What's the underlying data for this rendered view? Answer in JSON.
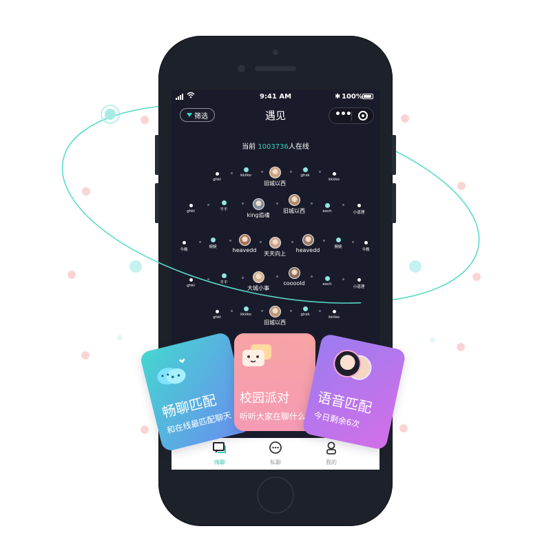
{
  "status_bar": {
    "time": "9:41 AM",
    "battery": "100%"
  },
  "nav": {
    "filter_label": "筛选",
    "title": "遇见"
  },
  "online": {
    "prefix": "当前 ",
    "count": "1003736",
    "suffix": "人在线"
  },
  "nodes": [
    {
      "label": "ghkl"
    },
    {
      "label": "kkiiko"
    },
    {
      "label": "旧城以西"
    },
    {
      "label": "ghsk"
    },
    {
      "label": "kkiiko"
    },
    {
      "label": "ghkl"
    },
    {
      "label": "千千"
    },
    {
      "label": "king追魂"
    },
    {
      "label": "旧城以西"
    },
    {
      "label": "eoch"
    },
    {
      "label": "小道理"
    },
    {
      "label": "今晚"
    },
    {
      "label": "婉婉"
    },
    {
      "label": "heavedd"
    },
    {
      "label": "天天向上"
    },
    {
      "label": "heavedd"
    },
    {
      "label": "婉婉"
    },
    {
      "label": "今晚"
    },
    {
      "label": "ghkl"
    },
    {
      "label": "千千"
    },
    {
      "label": "大城小事"
    },
    {
      "label": "coooold"
    },
    {
      "label": "eoch"
    },
    {
      "label": "小道理"
    },
    {
      "label": "ghkl"
    },
    {
      "label": "kkiiko"
    },
    {
      "label": "旧城以西"
    },
    {
      "label": "ghsk"
    },
    {
      "label": "kkiiko"
    }
  ],
  "tabs": [
    {
      "label": "嗨聊",
      "icon": "chat-bubbles-icon",
      "active": true
    },
    {
      "label": "私聊",
      "icon": "message-icon",
      "active": false
    },
    {
      "label": "我的",
      "icon": "profile-icon",
      "active": false
    }
  ],
  "cards": {
    "chat_match": {
      "title": "畅聊匹配",
      "subtitle": "和在线最匹配聊天"
    },
    "campus_party": {
      "title": "校园派对",
      "subtitle": "听听大家在聊什么"
    },
    "voice_match": {
      "title": "语音匹配",
      "subtitle": "今日剩余6次"
    }
  },
  "colors": {
    "accent": "#37d4c4",
    "screen_bg": "#1a1b2a",
    "phone_body": "#1d212a",
    "card_chat_from": "#6a8cf0",
    "card_chat_to": "#45d6d0",
    "card_party_from": "#f7a4a4",
    "card_party_to": "#f59ab3",
    "card_voice_from": "#9b7cf0",
    "card_voice_to": "#d36fe8",
    "decor_dot_pink": "#fad4d4",
    "decor_dot_cyan": "#c4f2f0"
  }
}
